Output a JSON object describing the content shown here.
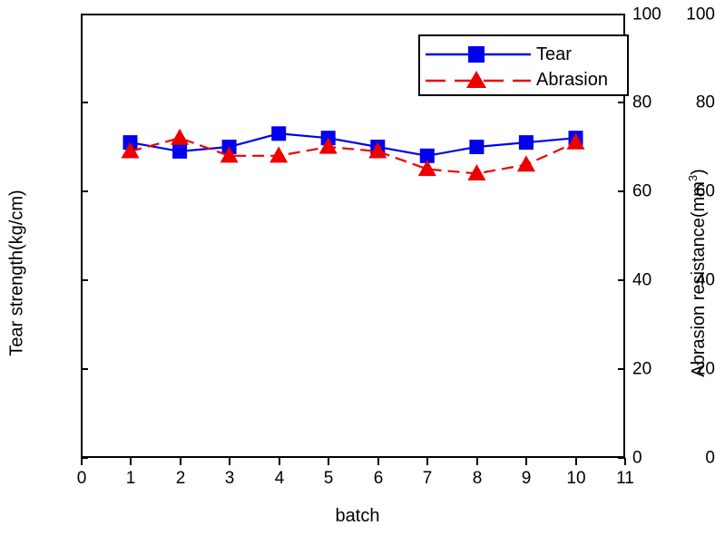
{
  "chart_data": {
    "type": "line",
    "title": "",
    "xlabel": "batch",
    "ylabel": "Tear strength(kg/cm)",
    "ylabel_right": "Abrasion resistance(mm",
    "ylabel_right_sup": "3",
    "ylabel_right_suffix": ")",
    "x": [
      1,
      2,
      3,
      4,
      5,
      6,
      7,
      8,
      9,
      10
    ],
    "xlim": [
      0,
      11
    ],
    "ylim": [
      0,
      100
    ],
    "ylim_right": [
      0,
      100
    ],
    "xticks": [
      "0",
      "1",
      "2",
      "3",
      "4",
      "5",
      "6",
      "7",
      "8",
      "9",
      "10",
      "11"
    ],
    "yticks": [
      "0",
      "20",
      "40",
      "60",
      "80",
      "100"
    ],
    "yticks_right": [
      "0",
      "20",
      "40",
      "60",
      "80",
      "100"
    ],
    "grid": false,
    "legend_position": "top-right inside",
    "series": [
      {
        "name": "Tear",
        "color": "#0000ee",
        "marker": "square",
        "linestyle": "solid",
        "axis": "left",
        "values": [
          71,
          69,
          70,
          73,
          72,
          70,
          68,
          70,
          71,
          72
        ]
      },
      {
        "name": "Abrasion",
        "color": "#ee0000",
        "marker": "triangle",
        "linestyle": "dashed",
        "axis": "right",
        "values": [
          69,
          72,
          68,
          68,
          70,
          69,
          65,
          64,
          66,
          71
        ]
      }
    ]
  },
  "legend": {
    "items": [
      {
        "label": "Tear"
      },
      {
        "label": "Abrasion"
      }
    ]
  },
  "axes": {
    "x_title": "batch",
    "y_left_title": "Tear strength(kg/cm)",
    "y_right_title_main": "Abrasion resistance(mm",
    "y_right_title_sup": "3",
    "y_right_title_end": ")"
  }
}
